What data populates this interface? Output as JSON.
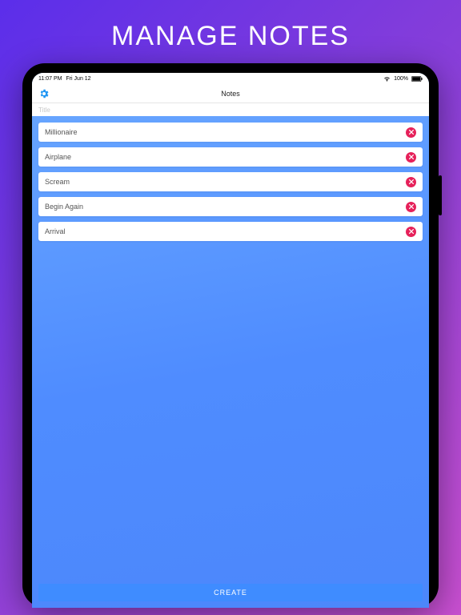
{
  "promo": {
    "title": "MANAGE NOTES"
  },
  "status": {
    "time": "11:07 PM",
    "date": "Fri Jun 12",
    "battery": "100%"
  },
  "nav": {
    "title": "Notes"
  },
  "title_input": {
    "placeholder": "Title",
    "value": ""
  },
  "notes": [
    {
      "label": "Millionaire"
    },
    {
      "label": "Airplane"
    },
    {
      "label": "Scream"
    },
    {
      "label": "Begin Again"
    },
    {
      "label": "Arrival"
    }
  ],
  "actions": {
    "create": "CREATE"
  },
  "colors": {
    "accent": "#3f8cff",
    "delete": "#e6215a",
    "settings": "#2196f3"
  }
}
